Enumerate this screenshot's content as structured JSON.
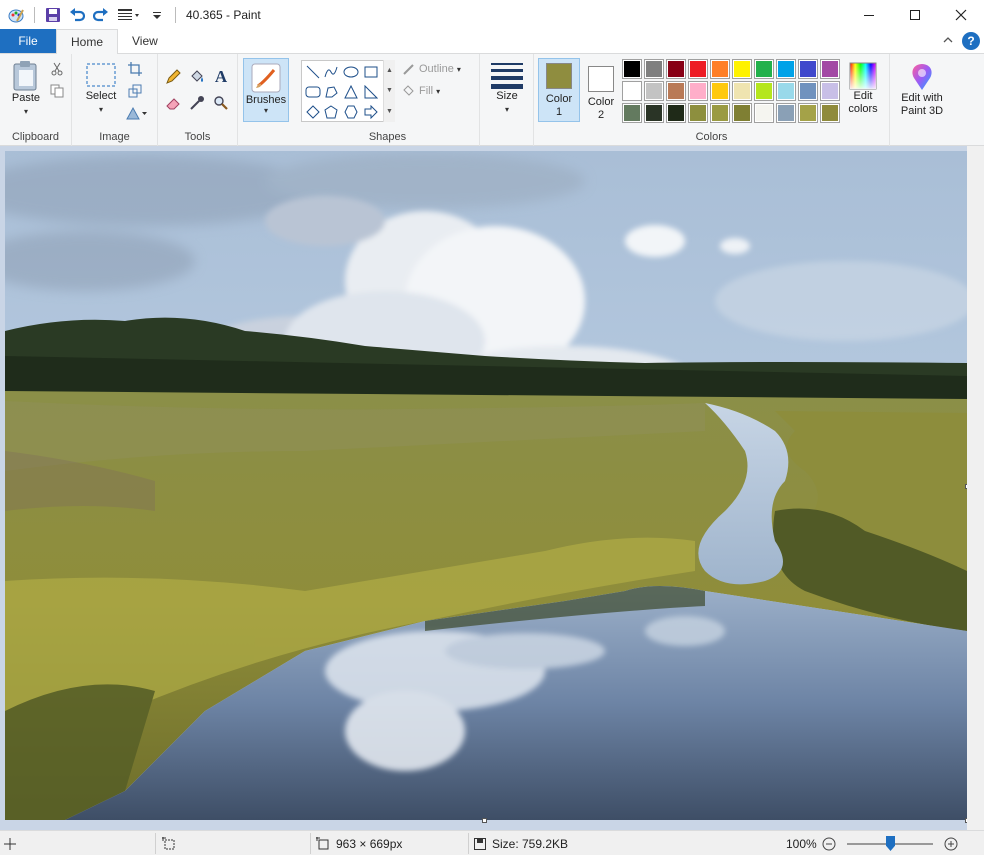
{
  "window": {
    "title": "40.365 - Paint"
  },
  "tabs": {
    "file": "File",
    "home": "Home",
    "view": "View"
  },
  "clipboard": {
    "paste": "Paste",
    "label": "Clipboard"
  },
  "image": {
    "select": "Select",
    "label": "Image"
  },
  "tools": {
    "label": "Tools"
  },
  "brushes": {
    "label": "Brushes"
  },
  "shapes": {
    "label": "Shapes",
    "outline": "Outline",
    "fill": "Fill"
  },
  "size": {
    "label": "Size"
  },
  "colors": {
    "color1_line1": "Color",
    "color1_line2": "1",
    "color2_line1": "Color",
    "color2_line2": "2",
    "edit_line1": "Edit",
    "edit_line2": "colors",
    "label": "Colors",
    "color1_value": "#8f8d3f",
    "color2_value": "#ffffff",
    "palette": [
      "#000000",
      "#7f7f7f",
      "#880015",
      "#ed1c24",
      "#ff7f27",
      "#fff200",
      "#22b14c",
      "#00a2e8",
      "#3f48cc",
      "#a349a4",
      "#ffffff",
      "#c3c3c3",
      "#b97a57",
      "#ffaec9",
      "#ffc90e",
      "#efe4b0",
      "#b5e61d",
      "#99d9ea",
      "#7092be",
      "#c8bfe7",
      "#637a5f",
      "#2a3426",
      "#1f2a18",
      "#8d8f3e",
      "#9a9a42",
      "#7f7f33",
      "#f5f5f0",
      "#8aa0b6",
      "#a4a248",
      "#8f8a3b"
    ]
  },
  "paint3d": {
    "line1": "Edit with",
    "line2": "Paint 3D"
  },
  "status": {
    "dimensions": "963 × 669px",
    "size": "Size: 759.2KB",
    "zoom": "100%"
  }
}
